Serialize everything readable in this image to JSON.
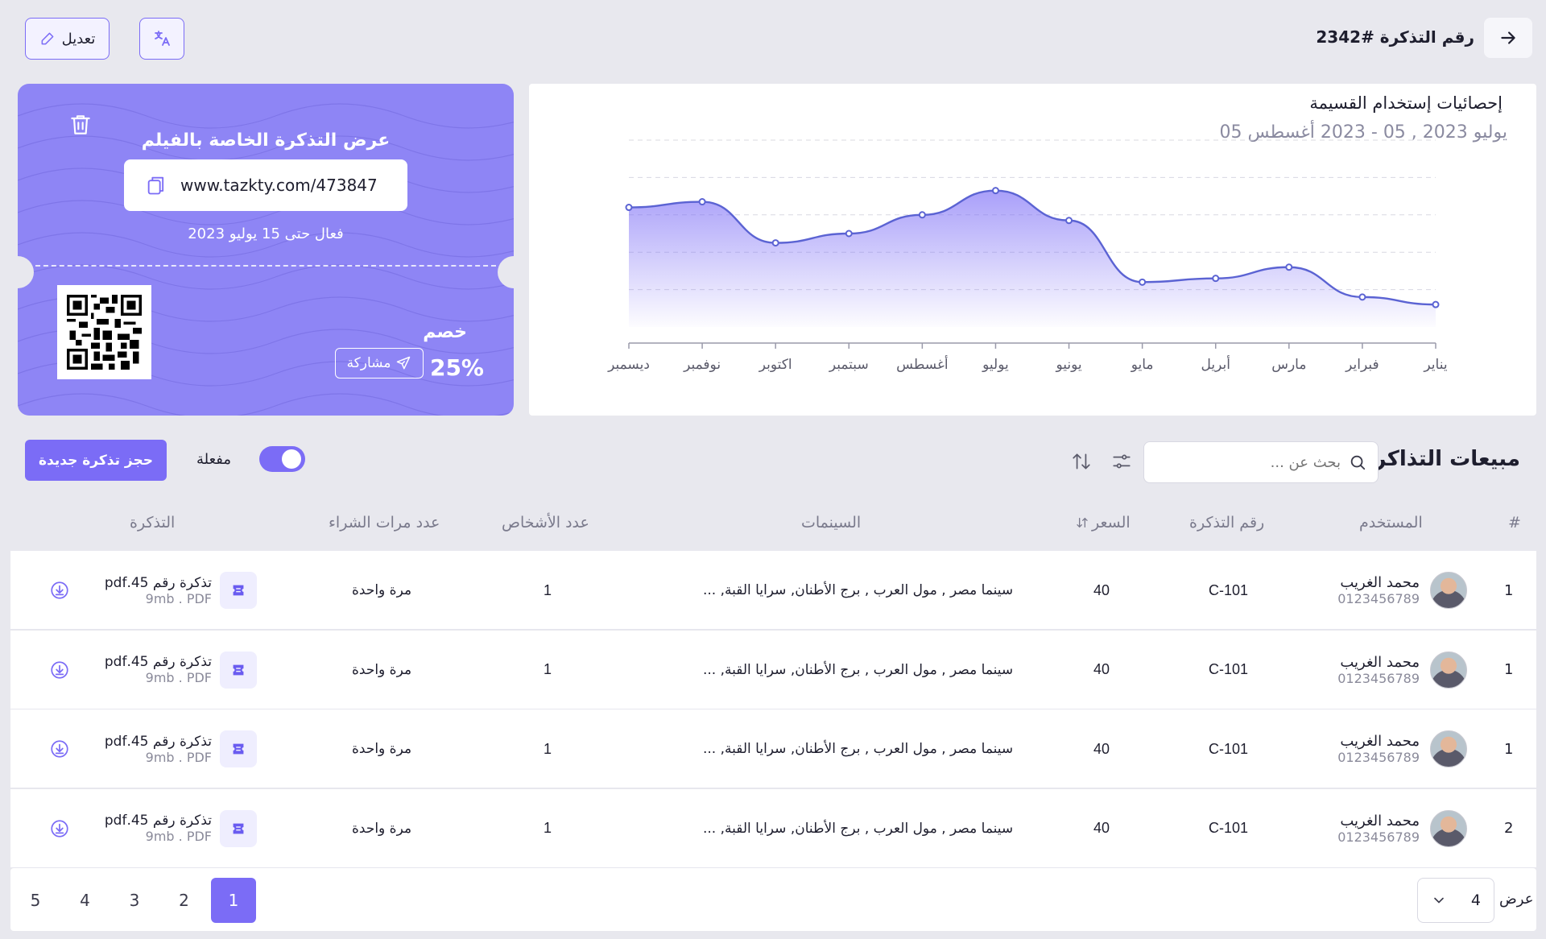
{
  "header": {
    "ticket_title": "رقم التذكرة #2342",
    "edit_label": "تعديل"
  },
  "chart_card": {
    "title": "إحصائيات إستخدام القسيمة",
    "date_range": "يوليو 2023 , 05 - 2023 أغسطس 05"
  },
  "chart_data": {
    "type": "area",
    "categories": [
      "يناير",
      "فبراير",
      "مارس",
      "أبريل",
      "مايو",
      "يونيو",
      "يوليو",
      "أغسطس",
      "سبتمبر",
      "اكتوبر",
      "نوفمبر",
      "ديسمبر"
    ],
    "series": [
      {
        "values": [
          12,
          16,
          32,
          26,
          24,
          57,
          73,
          60,
          50,
          45,
          67,
          64
        ]
      }
    ],
    "ylim": [
      0,
      100
    ],
    "grid": true,
    "color": "#5b63d3"
  },
  "coupon": {
    "title": "عرض التذكرة الخاصة بالفيلم",
    "url": "www.tazkty.com/473847",
    "valid_until": "فعال حتى 15 يوليو 2023",
    "discount_label": "خصم",
    "discount_value": "25%",
    "share_label": "مشاركة",
    "bg_color": "#8e85f5"
  },
  "sales": {
    "title": "مبيعات التذاكر",
    "search_placeholder": "بحث عن ...",
    "toggle_label": "مفعلة",
    "toggle_on": true,
    "new_booking_label": "حجز تذكرة جديدة"
  },
  "table": {
    "headers": {
      "index": "#",
      "user": "المستخدم",
      "ticket_no": "رقم التذكرة",
      "price": "السعر",
      "cinemas": "السينمات",
      "people": "عدد الأشخاص",
      "purchases": "عدد مرات الشراء",
      "ticket": "التذكرة"
    },
    "rows": [
      {
        "index": "1",
        "name": "محمد الغريب",
        "phone": "0123456789",
        "ticket_no": "C-101",
        "price": "40",
        "cinemas": "سينما مصر , مول العرب , برج الأطنان, سرايا القبة, ...",
        "people": "1",
        "purchases": "مرة واحدة",
        "file_name": "تذكرة رقم 45.pdf",
        "file_meta": "9mb . PDF"
      },
      {
        "index": "1",
        "name": "محمد الغريب",
        "phone": "0123456789",
        "ticket_no": "C-101",
        "price": "40",
        "cinemas": "سينما مصر , مول العرب , برج الأطنان, سرايا القبة, ...",
        "people": "1",
        "purchases": "مرة واحدة",
        "file_name": "تذكرة رقم 45.pdf",
        "file_meta": "9mb . PDF"
      },
      {
        "index": "1",
        "name": "محمد الغريب",
        "phone": "0123456789",
        "ticket_no": "C-101",
        "price": "40",
        "cinemas": "سينما مصر , مول العرب , برج الأطنان, سرايا القبة, ...",
        "people": "1",
        "purchases": "مرة واحدة",
        "file_name": "تذكرة رقم 45.pdf",
        "file_meta": "9mb . PDF"
      },
      {
        "index": "2",
        "name": "محمد الغريب",
        "phone": "0123456789",
        "ticket_no": "C-101",
        "price": "40",
        "cinemas": "سينما مصر , مول العرب , برج الأطنان, سرايا القبة, ...",
        "people": "1",
        "purchases": "مرة واحدة",
        "file_name": "تذكرة رقم 45.pdf",
        "file_meta": "9mb . PDF"
      }
    ]
  },
  "pagination": {
    "pages": [
      "1",
      "2",
      "3",
      "4",
      "5"
    ],
    "active": "1",
    "show_label": "عرض",
    "per_page": "4"
  },
  "colors": {
    "accent": "#7b6cf6",
    "accent_dark": "#6a5cf0"
  }
}
